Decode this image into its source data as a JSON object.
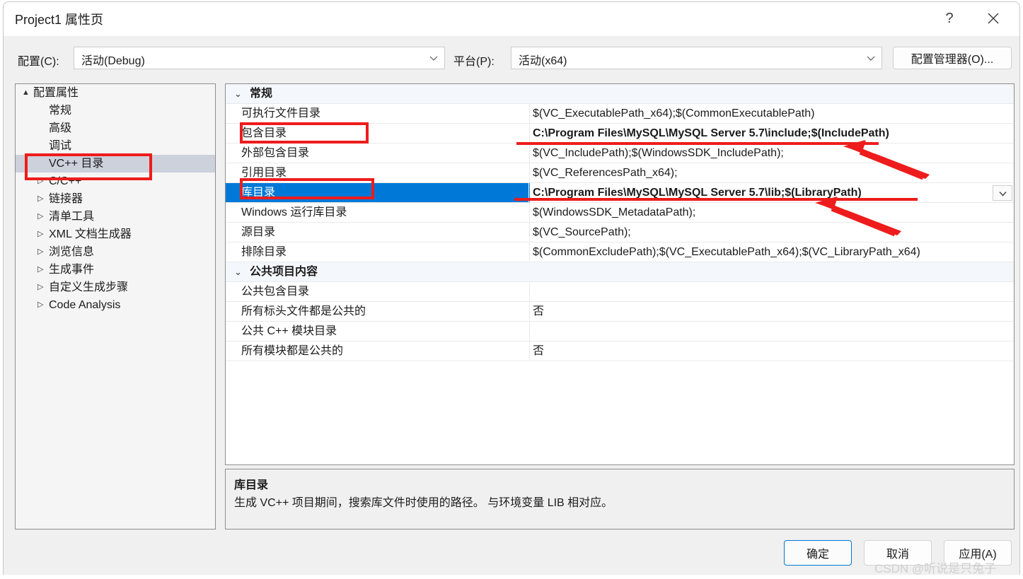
{
  "window": {
    "title": "Project1 属性页",
    "help_icon": "question-mark-icon",
    "close_icon": "close-icon"
  },
  "configbar": {
    "config_label": "配置(C):",
    "config_value": "活动(Debug)",
    "platform_label": "平台(P):",
    "platform_value": "活动(x64)",
    "config_manager_button": "配置管理器(O)..."
  },
  "sidebar": {
    "items": [
      {
        "label": "配置属性",
        "level": 0,
        "arrow": "▲",
        "selected": false
      },
      {
        "label": "常规",
        "level": 1,
        "arrow": "",
        "selected": false
      },
      {
        "label": "高级",
        "level": 1,
        "arrow": "",
        "selected": false
      },
      {
        "label": "调试",
        "level": 1,
        "arrow": "",
        "selected": false
      },
      {
        "label": "VC++ 目录",
        "level": 1,
        "arrow": "",
        "selected": true
      },
      {
        "label": "C/C++",
        "level": 1,
        "arrow": "▷",
        "selected": false
      },
      {
        "label": "链接器",
        "level": 1,
        "arrow": "▷",
        "selected": false
      },
      {
        "label": "清单工具",
        "level": 1,
        "arrow": "▷",
        "selected": false
      },
      {
        "label": "XML 文档生成器",
        "level": 1,
        "arrow": "▷",
        "selected": false
      },
      {
        "label": "浏览信息",
        "level": 1,
        "arrow": "▷",
        "selected": false
      },
      {
        "label": "生成事件",
        "level": 1,
        "arrow": "▷",
        "selected": false
      },
      {
        "label": "自定义生成步骤",
        "level": 1,
        "arrow": "▷",
        "selected": false
      },
      {
        "label": "Code Analysis",
        "level": 1,
        "arrow": "▷",
        "selected": false
      }
    ]
  },
  "propgrid": {
    "categories": [
      {
        "name": "常规",
        "chevron": "⌄",
        "rows": [
          {
            "name": "可执行文件目录",
            "value": "$(VC_ExecutablePath_x64);$(CommonExecutablePath)",
            "bold": false,
            "selected": false
          },
          {
            "name": "包含目录",
            "value": "C:\\Program Files\\MySQL\\MySQL Server 5.7\\include;$(IncludePath)",
            "bold": true,
            "selected": false
          },
          {
            "name": "外部包含目录",
            "value": "$(VC_IncludePath);$(WindowsSDK_IncludePath);",
            "bold": false,
            "selected": false
          },
          {
            "name": "引用目录",
            "value": "$(VC_ReferencesPath_x64);",
            "bold": false,
            "selected": false
          },
          {
            "name": "库目录",
            "value": "C:\\Program Files\\MySQL\\MySQL Server 5.7\\lib;$(LibraryPath)",
            "bold": true,
            "selected": true
          },
          {
            "name": "Windows 运行库目录",
            "value": "$(WindowsSDK_MetadataPath);",
            "bold": false,
            "selected": false
          },
          {
            "name": "源目录",
            "value": "$(VC_SourcePath);",
            "bold": false,
            "selected": false
          },
          {
            "name": "排除目录",
            "value": "$(CommonExcludePath);$(VC_ExecutablePath_x64);$(VC_LibraryPath_x64)",
            "bold": false,
            "selected": false
          }
        ]
      },
      {
        "name": "公共项目内容",
        "chevron": "⌄",
        "rows": [
          {
            "name": "公共包含目录",
            "value": "",
            "bold": false,
            "selected": false
          },
          {
            "name": "所有标头文件都是公共的",
            "value": "否",
            "bold": false,
            "selected": false
          },
          {
            "name": "公共 C++ 模块目录",
            "value": "",
            "bold": false,
            "selected": false
          },
          {
            "name": "所有模块都是公共的",
            "value": "否",
            "bold": false,
            "selected": false
          }
        ]
      }
    ],
    "row_dropdown_icon": "chevron-down-icon"
  },
  "description": {
    "title": "库目录",
    "body": "生成 VC++ 项目期间，搜索库文件时使用的路径。 与环境变量 LIB 相对应。"
  },
  "footer": {
    "ok": "确定",
    "cancel": "取消",
    "apply": "应用(A)"
  },
  "annotations": {
    "color": "#ee1c1c",
    "boxes": [
      "vc++-directories-sidebar-item",
      "include-directories-name",
      "library-directories-name"
    ],
    "underlines": [
      "include-directories-value",
      "library-directories-value"
    ],
    "arrows": [
      "arrow-to-include-value",
      "arrow-to-library-value"
    ]
  },
  "watermark": "CSDN @听说是只兔子"
}
